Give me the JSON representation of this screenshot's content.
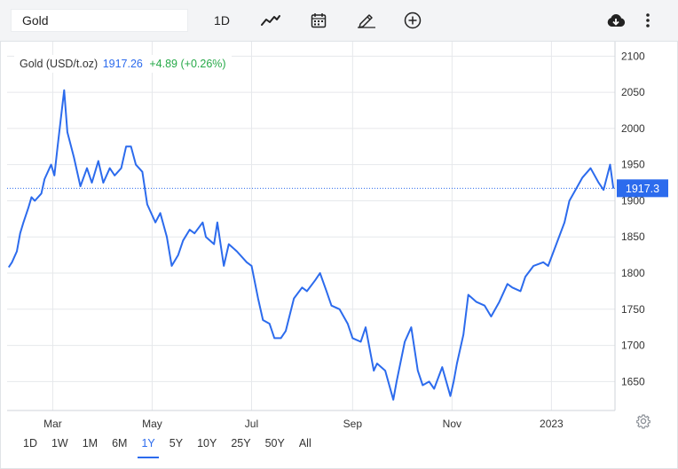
{
  "toolbar": {
    "search_value": "Gold",
    "interval_label": "1D",
    "icons": [
      "line-style-icon",
      "calendar-icon",
      "pencil-icon",
      "plus-circle-icon",
      "cloud-download-icon",
      "more-vertical-icon"
    ]
  },
  "legend": {
    "name": "Gold (USD/t.oz)",
    "price": "1917.26",
    "change": "+4.89 (+0.26%)"
  },
  "price_tag": "1917.3",
  "ranges": [
    {
      "label": "1D",
      "active": false
    },
    {
      "label": "1W",
      "active": false
    },
    {
      "label": "1M",
      "active": false
    },
    {
      "label": "6M",
      "active": false
    },
    {
      "label": "1Y",
      "active": true
    },
    {
      "label": "5Y",
      "active": false
    },
    {
      "label": "10Y",
      "active": false
    },
    {
      "label": "25Y",
      "active": false
    },
    {
      "label": "50Y",
      "active": false
    },
    {
      "label": "All",
      "active": false
    }
  ],
  "colors": {
    "line": "#2c6bed",
    "up": "#26a948",
    "accent": "#2c6bed",
    "grid": "#e6e8eb"
  },
  "chart_data": {
    "type": "line",
    "title": "",
    "xlabel": "",
    "ylabel": "",
    "ylim": [
      1610,
      2120
    ],
    "yticks": [
      1650,
      1700,
      1750,
      1800,
      1850,
      1900,
      1950,
      2000,
      2050,
      2100
    ],
    "xticks": [
      {
        "label": "Mar",
        "date": "2022-03-01"
      },
      {
        "label": "May",
        "date": "2022-05-01"
      },
      {
        "label": "Jul",
        "date": "2022-07-01"
      },
      {
        "label": "Sep",
        "date": "2022-09-01"
      },
      {
        "label": "Nov",
        "date": "2022-11-01"
      },
      {
        "label": "2023",
        "date": "2023-01-01"
      }
    ],
    "x_range": [
      "2022-02-01",
      "2023-02-09"
    ],
    "last_price": 1917.3,
    "grid": true,
    "series": [
      {
        "x": [
          "2022-02-02",
          "2022-02-04",
          "2022-02-07",
          "2022-02-09",
          "2022-02-11",
          "2022-02-14",
          "2022-02-16",
          "2022-02-18",
          "2022-02-22",
          "2022-02-24",
          "2022-02-28",
          "2022-03-02",
          "2022-03-04",
          "2022-03-08",
          "2022-03-10",
          "2022-03-14",
          "2022-03-18",
          "2022-03-22",
          "2022-03-25",
          "2022-03-29",
          "2022-04-01",
          "2022-04-05",
          "2022-04-08",
          "2022-04-12",
          "2022-04-15",
          "2022-04-18",
          "2022-04-21",
          "2022-04-25",
          "2022-04-28",
          "2022-05-03",
          "2022-05-06",
          "2022-05-10",
          "2022-05-13",
          "2022-05-17",
          "2022-05-20",
          "2022-05-24",
          "2022-05-27",
          "2022-06-01",
          "2022-06-03",
          "2022-06-08",
          "2022-06-10",
          "2022-06-14",
          "2022-06-17",
          "2022-06-22",
          "2022-06-28",
          "2022-07-01",
          "2022-07-05",
          "2022-07-08",
          "2022-07-12",
          "2022-07-15",
          "2022-07-19",
          "2022-07-22",
          "2022-07-27",
          "2022-08-01",
          "2022-08-04",
          "2022-08-09",
          "2022-08-12",
          "2022-08-16",
          "2022-08-19",
          "2022-08-24",
          "2022-08-29",
          "2022-09-01",
          "2022-09-06",
          "2022-09-09",
          "2022-09-14",
          "2022-09-16",
          "2022-09-21",
          "2022-09-26",
          "2022-09-28",
          "2022-10-03",
          "2022-10-07",
          "2022-10-11",
          "2022-10-14",
          "2022-10-18",
          "2022-10-21",
          "2022-10-26",
          "2022-10-31",
          "2022-11-02",
          "2022-11-04",
          "2022-11-08",
          "2022-11-11",
          "2022-11-16",
          "2022-11-21",
          "2022-11-25",
          "2022-11-30",
          "2022-12-05",
          "2022-12-08",
          "2022-12-13",
          "2022-12-16",
          "2022-12-21",
          "2022-12-27",
          "2022-12-30",
          "2023-01-04",
          "2023-01-09",
          "2023-01-12",
          "2023-01-17",
          "2023-01-20",
          "2023-01-25",
          "2023-01-30",
          "2023-02-02",
          "2023-02-06",
          "2023-02-08"
        ],
        "values": [
          1808,
          1815,
          1830,
          1855,
          1870,
          1890,
          1905,
          1900,
          1910,
          1930,
          1950,
          1935,
          1975,
          2053,
          1995,
          1960,
          1920,
          1945,
          1925,
          1955,
          1925,
          1945,
          1935,
          1945,
          1975,
          1975,
          1950,
          1940,
          1895,
          1870,
          1883,
          1850,
          1810,
          1825,
          1845,
          1860,
          1855,
          1870,
          1850,
          1840,
          1870,
          1810,
          1840,
          1830,
          1815,
          1810,
          1765,
          1735,
          1730,
          1710,
          1710,
          1720,
          1765,
          1780,
          1775,
          1790,
          1800,
          1775,
          1755,
          1750,
          1730,
          1710,
          1705,
          1725,
          1665,
          1675,
          1665,
          1625,
          1650,
          1705,
          1725,
          1665,
          1645,
          1650,
          1640,
          1670,
          1630,
          1650,
          1675,
          1715,
          1770,
          1760,
          1755,
          1740,
          1760,
          1785,
          1780,
          1775,
          1795,
          1810,
          1815,
          1810,
          1840,
          1870,
          1900,
          1920,
          1932,
          1945,
          1925,
          1915,
          1950,
          1917
        ]
      }
    ]
  }
}
